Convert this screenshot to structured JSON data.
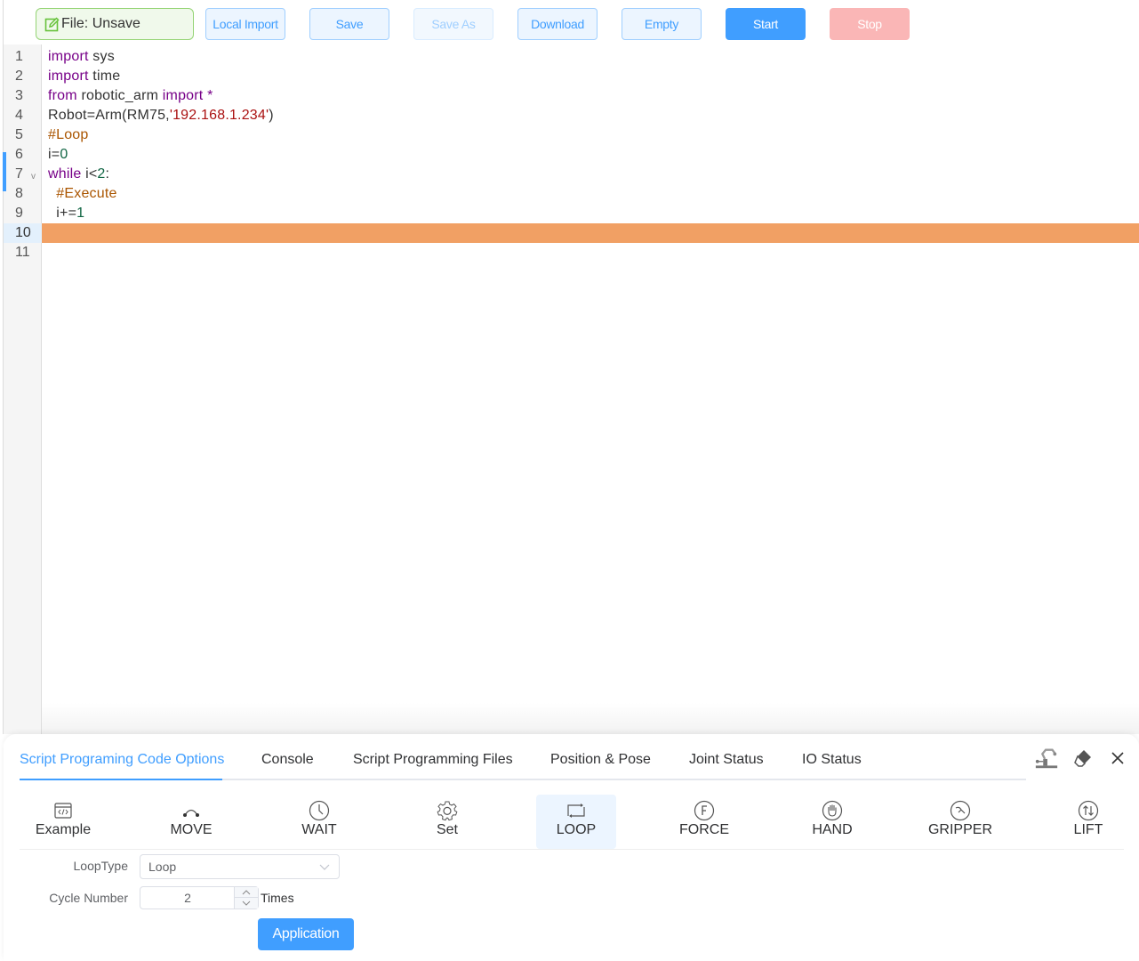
{
  "toolbar": {
    "file_label": "File:",
    "file_status": "Unsave",
    "buttons": {
      "local_import": "Local Import",
      "save": "Save",
      "save_as": "Save As",
      "download": "Download",
      "empty": "Empty",
      "start": "Start",
      "stop": "Stop"
    }
  },
  "editor": {
    "active_line": 10,
    "lines": [
      {
        "n": "1",
        "tokens": [
          {
            "t": "import",
            "c": "kw"
          },
          {
            "t": " sys",
            "c": ""
          }
        ]
      },
      {
        "n": "2",
        "tokens": [
          {
            "t": "import",
            "c": "kw"
          },
          {
            "t": " time",
            "c": ""
          }
        ]
      },
      {
        "n": "3",
        "tokens": [
          {
            "t": "from",
            "c": "kw"
          },
          {
            "t": " robotic_arm ",
            "c": ""
          },
          {
            "t": "import",
            "c": "kw"
          },
          {
            "t": " *",
            "c": "kw"
          }
        ]
      },
      {
        "n": "4",
        "tokens": [
          {
            "t": "Robot=Arm(RM75,",
            "c": ""
          },
          {
            "t": "'192.168.1.234'",
            "c": "str"
          },
          {
            "t": ")",
            "c": ""
          }
        ]
      },
      {
        "n": "5",
        "tokens": [
          {
            "t": "#Loop",
            "c": "cmt"
          }
        ]
      },
      {
        "n": "6",
        "tokens": [
          {
            "t": "i=",
            "c": ""
          },
          {
            "t": "0",
            "c": "num"
          }
        ]
      },
      {
        "n": "7",
        "tokens": [
          {
            "t": "while",
            "c": "kw"
          },
          {
            "t": " i<",
            "c": ""
          },
          {
            "t": "2",
            "c": "num"
          },
          {
            "t": ":",
            "c": ""
          }
        ]
      },
      {
        "n": "8",
        "tokens": [
          {
            "t": "  #Execute",
            "c": "cmt"
          }
        ]
      },
      {
        "n": "9",
        "tokens": [
          {
            "t": "  i+=",
            "c": ""
          },
          {
            "t": "1",
            "c": "num"
          }
        ]
      },
      {
        "n": "10",
        "tokens": []
      },
      {
        "n": "11",
        "tokens": []
      }
    ],
    "fold_marker": "v"
  },
  "panel": {
    "tabs": [
      {
        "label": "Script Programing Code Options",
        "active": true
      },
      {
        "label": "Console",
        "active": false
      },
      {
        "label": "Script Programming Files",
        "active": false
      },
      {
        "label": "Position & Pose",
        "active": false
      },
      {
        "label": "Joint Status",
        "active": false
      },
      {
        "label": "IO Status",
        "active": false
      }
    ],
    "header_icons": [
      "robot-arm-icon",
      "eraser-icon",
      "close-icon"
    ],
    "options": [
      {
        "label": "Example",
        "icon": "code-window-icon",
        "active": false
      },
      {
        "label": "MOVE",
        "icon": "arc-move-icon",
        "active": false
      },
      {
        "label": "WAIT",
        "icon": "clock-icon",
        "active": false
      },
      {
        "label": "Set",
        "icon": "gear-icon",
        "active": false
      },
      {
        "label": "LOOP",
        "icon": "loop-icon",
        "active": true
      },
      {
        "label": "FORCE",
        "icon": "force-icon",
        "active": false
      },
      {
        "label": "HAND",
        "icon": "hand-icon",
        "active": false
      },
      {
        "label": "GRIPPER",
        "icon": "gripper-icon",
        "active": false
      },
      {
        "label": "LIFT",
        "icon": "lift-icon",
        "active": false
      }
    ],
    "form": {
      "loop_type_label": "LoopType",
      "loop_type_value": "Loop",
      "cycle_number_label": "Cycle Number",
      "cycle_number_value": "2",
      "cycle_unit": "Times",
      "apply_label": "Application"
    }
  },
  "colors": {
    "accent": "#409eff",
    "highlight_line": "#f1a064",
    "file_badge_border": "#95d475",
    "stop_disabled": "#fab6b6"
  }
}
